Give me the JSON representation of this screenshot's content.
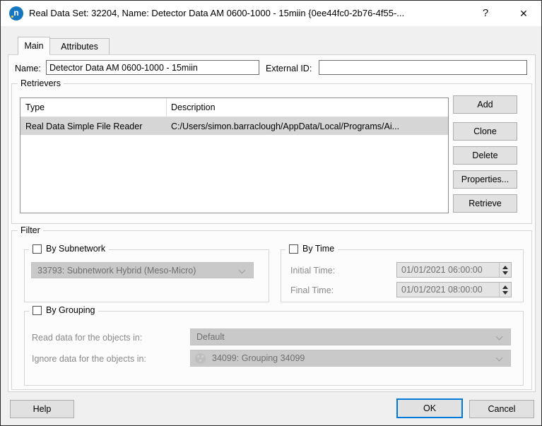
{
  "window": {
    "title": "Real Data Set: 32204, Name: Detector Data AM 0600-1000 - 15miin  {0ee44fc0-2b76-4f55-...",
    "app_icon": "aimsun-next-logo",
    "icon_letter": "n",
    "help_button": "?",
    "close_button": "✕"
  },
  "tabs": {
    "main": "Main",
    "attributes": "Attributes"
  },
  "form": {
    "name_label": "Name:",
    "name_value": "Detector Data AM 0600-1000 - 15miin",
    "external_id_label": "External ID:",
    "external_id_value": ""
  },
  "retrievers": {
    "legend": "Retrievers",
    "col_type": "Type",
    "col_description": "Description",
    "rows": [
      {
        "type": "Real Data Simple File Reader",
        "description": "C:/Users/simon.barraclough/AppData/Local/Programs/Ai..."
      }
    ],
    "btn_add": "Add",
    "btn_clone": "Clone",
    "btn_delete": "Delete",
    "btn_properties": "Properties...",
    "btn_retrieve": "Retrieve"
  },
  "filter": {
    "legend": "Filter",
    "by_subnetwork": {
      "label": "By Subnetwork",
      "checked": false,
      "value": "33793: Subnetwork Hybrid (Meso-Micro)"
    },
    "by_time": {
      "label": "By Time",
      "checked": false,
      "initial_label": "Initial Time:",
      "initial_value": "01/01/2021 06:00:00",
      "final_label": "Final Time:",
      "final_value": "01/01/2021 08:00:00"
    },
    "by_grouping": {
      "label": "By Grouping",
      "checked": false,
      "read_label": "Read data for the objects in:",
      "read_value": "Default",
      "ignore_label": "Ignore data for the objects in:",
      "ignore_icon": "grouping-icon",
      "ignore_value": "34099: Grouping 34099"
    }
  },
  "footer": {
    "help": "Help",
    "ok": "OK",
    "cancel": "Cancel"
  },
  "colors": {
    "accent": "#0078d7",
    "titlebar_bg": "#ffffff",
    "icon_blue": "#1577c2",
    "icon_dot_yellow": "#f3d23c",
    "selected_row_bg": "#d6d6d6",
    "disabled_field_bg": "#c9c9c9",
    "disabled_text": "#6f6f6f"
  }
}
